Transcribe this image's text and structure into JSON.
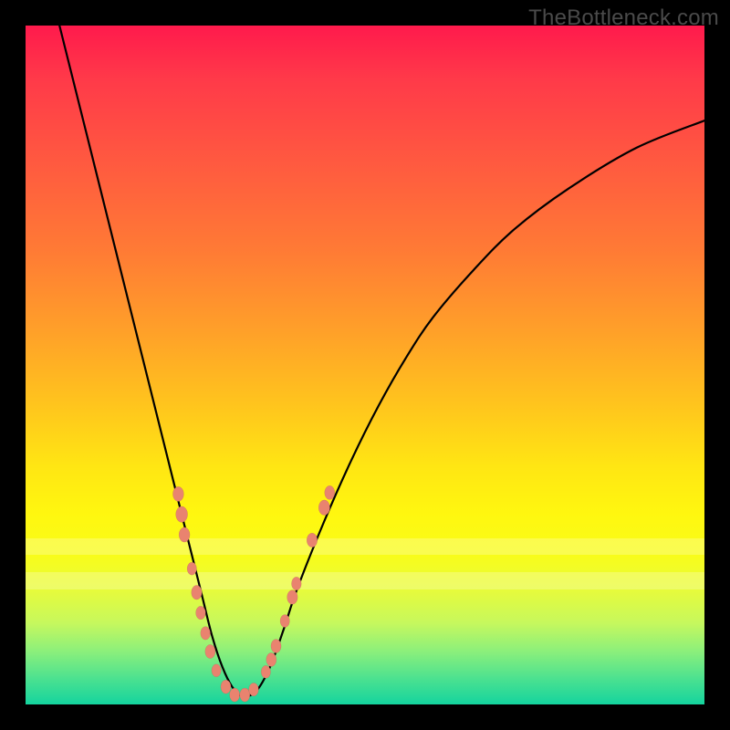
{
  "watermark": "TheBottleneck.com",
  "colors": {
    "marker": "#e9836f",
    "line": "#000000"
  },
  "chart_data": {
    "type": "line",
    "title": "",
    "xlabel": "",
    "ylabel": "",
    "xlim": [
      0,
      100
    ],
    "ylim": [
      0,
      100
    ],
    "grid": false,
    "legend": false,
    "pale_bands_y": [
      [
        22,
        24.5
      ],
      [
        17,
        19.5
      ]
    ],
    "series": [
      {
        "name": "bottleneck-curve",
        "x": [
          5,
          7,
          9,
          11,
          13,
          15,
          17,
          19,
          21,
          23,
          24.5,
          26,
          27.5,
          29,
          30.5,
          32,
          34,
          36,
          38,
          40,
          44,
          48,
          52,
          56,
          60,
          66,
          72,
          80,
          90,
          100
        ],
        "y": [
          100,
          92,
          84,
          76,
          68,
          60,
          52,
          44,
          36,
          28,
          22,
          16,
          10,
          5.5,
          2.5,
          1.2,
          2.0,
          5.5,
          11,
          17,
          27,
          36,
          44,
          51,
          57,
          64,
          70,
          76,
          82,
          86
        ]
      }
    ],
    "markers": {
      "name": "highlight-points",
      "points": [
        {
          "x": 22.5,
          "y": 31,
          "r": 6
        },
        {
          "x": 23.0,
          "y": 28,
          "r": 6.5
        },
        {
          "x": 23.4,
          "y": 25,
          "r": 6
        },
        {
          "x": 24.5,
          "y": 20,
          "r": 5.2
        },
        {
          "x": 25.2,
          "y": 16.5,
          "r": 5.8
        },
        {
          "x": 25.8,
          "y": 13.5,
          "r": 5.4
        },
        {
          "x": 26.5,
          "y": 10.5,
          "r": 5.4
        },
        {
          "x": 27.2,
          "y": 7.8,
          "r": 5.6
        },
        {
          "x": 28.1,
          "y": 5.0,
          "r": 5.2
        },
        {
          "x": 29.5,
          "y": 2.6,
          "r": 5.6
        },
        {
          "x": 30.8,
          "y": 1.4,
          "r": 5.6
        },
        {
          "x": 32.3,
          "y": 1.4,
          "r": 5.6
        },
        {
          "x": 33.6,
          "y": 2.2,
          "r": 5.4
        },
        {
          "x": 35.4,
          "y": 4.8,
          "r": 5.2
        },
        {
          "x": 36.2,
          "y": 6.6,
          "r": 5.6
        },
        {
          "x": 36.9,
          "y": 8.6,
          "r": 5.6
        },
        {
          "x": 38.2,
          "y": 12.3,
          "r": 5.2
        },
        {
          "x": 39.3,
          "y": 15.8,
          "r": 5.8
        },
        {
          "x": 39.9,
          "y": 17.8,
          "r": 5.4
        },
        {
          "x": 42.2,
          "y": 24.2,
          "r": 5.8
        },
        {
          "x": 44.0,
          "y": 29.0,
          "r": 6.2
        },
        {
          "x": 44.8,
          "y": 31.2,
          "r": 5.6
        }
      ]
    }
  }
}
